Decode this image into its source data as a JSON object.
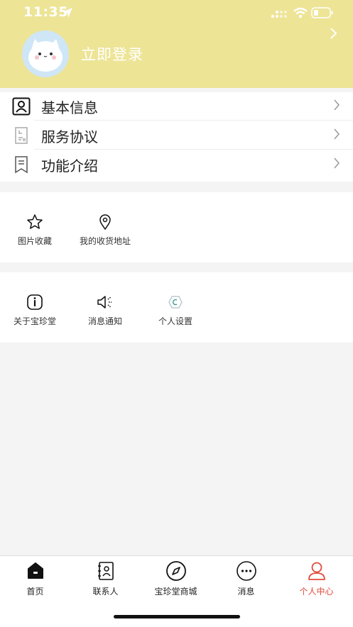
{
  "status_bar": {
    "time": "11:35"
  },
  "header": {
    "login_label": "立即登录"
  },
  "menu": [
    {
      "label": "基本信息",
      "icon": "user-card-icon"
    },
    {
      "label": "服务协议",
      "icon": "document-icon"
    },
    {
      "label": "功能介绍",
      "icon": "bookmark-doc-icon"
    }
  ],
  "card1": [
    {
      "label": "图片收藏",
      "icon": "star-icon"
    },
    {
      "label": "我的收货地址",
      "icon": "location-pin-icon"
    }
  ],
  "card2": [
    {
      "label": "关于宝珍堂",
      "icon": "info-icon"
    },
    {
      "label": "消息通知",
      "icon": "speaker-icon"
    },
    {
      "label": "个人设置",
      "icon": "settings-hexagon-icon"
    }
  ],
  "tabbar": {
    "items": [
      {
        "label": "首页",
        "icon": "home-icon"
      },
      {
        "label": "联系人",
        "icon": "contacts-icon"
      },
      {
        "label": "宝珍堂商城",
        "icon": "compass-icon"
      },
      {
        "label": "消息",
        "icon": "chat-bubble-icon"
      },
      {
        "label": "个人中心",
        "icon": "person-icon"
      }
    ],
    "active_index": 4,
    "active_color": "#e04b3c"
  },
  "colors": {
    "header_bg": "#ede496",
    "page_bg": "#f4f4f4",
    "accent": "#e04b3c"
  }
}
